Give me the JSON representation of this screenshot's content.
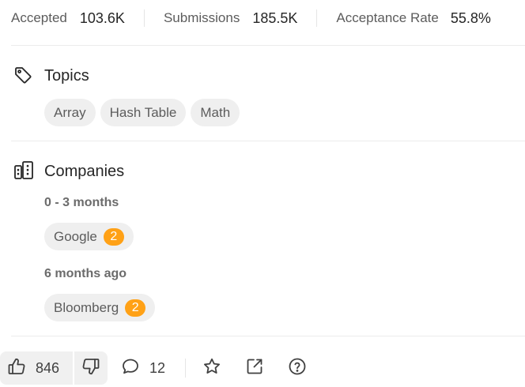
{
  "stats": {
    "accepted_label": "Accepted",
    "accepted_value": "103.6K",
    "submissions_label": "Submissions",
    "submissions_value": "185.5K",
    "acceptance_label": "Acceptance Rate",
    "acceptance_value": "55.8%"
  },
  "topics": {
    "title": "Topics",
    "icon": "tag-icon",
    "tags": [
      "Array",
      "Hash Table",
      "Math"
    ]
  },
  "companies": {
    "title": "Companies",
    "icon": "building-icon",
    "groups": [
      {
        "period": "0 - 3 months",
        "items": [
          {
            "name": "Google",
            "count": "2"
          }
        ]
      },
      {
        "period": "6 months ago",
        "items": [
          {
            "name": "Bloomberg",
            "count": "2"
          }
        ]
      }
    ]
  },
  "actions": {
    "likes": "846",
    "comments": "12",
    "icons": [
      "thumbs-up-icon",
      "thumbs-down-icon",
      "comment-icon",
      "star-icon",
      "share-icon",
      "help-icon"
    ]
  },
  "colors": {
    "badge": "#ffa116",
    "tag_bg": "#efefef",
    "text_primary": "#262626",
    "text_secondary": "#5c5c5c"
  }
}
